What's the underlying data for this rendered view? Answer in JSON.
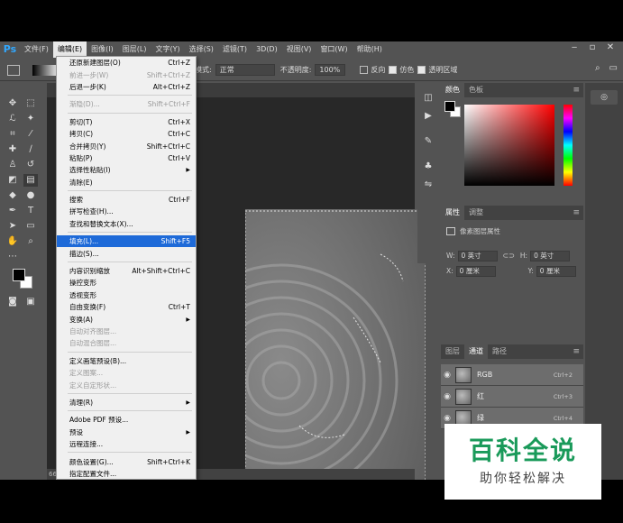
{
  "app": {
    "logo": "Ps"
  },
  "menubar": {
    "items": [
      "文件(F)",
      "编辑(E)",
      "图像(I)",
      "图层(L)",
      "文字(Y)",
      "选择(S)",
      "滤镜(T)",
      "3D(D)",
      "视图(V)",
      "窗口(W)",
      "帮助(H)"
    ],
    "active_index": 1,
    "window_controls": [
      "‒",
      "▫",
      "✕"
    ]
  },
  "options_bar": {
    "mode_label": "模式:",
    "mode_value": "正常",
    "opacity_label": "不透明度:",
    "opacity_value": "100%",
    "reverse_label": "反向",
    "dither_label": "仿色",
    "transparency_label": "透明区域"
  },
  "status_bar": {
    "zoom": "66"
  },
  "edit_menu": {
    "items": [
      {
        "label": "还原新建图层(O)",
        "shortcut": "Ctrl+Z",
        "disabled": false
      },
      {
        "label": "前进一步(W)",
        "shortcut": "Shift+Ctrl+Z",
        "disabled": true
      },
      {
        "label": "后退一步(K)",
        "shortcut": "Alt+Ctrl+Z",
        "disabled": false
      },
      {
        "sep": true
      },
      {
        "label": "渐隐(D)...",
        "shortcut": "Shift+Ctrl+F",
        "disabled": true
      },
      {
        "sep": true
      },
      {
        "label": "剪切(T)",
        "shortcut": "Ctrl+X",
        "disabled": false
      },
      {
        "label": "拷贝(C)",
        "shortcut": "Ctrl+C",
        "disabled": false
      },
      {
        "label": "合并拷贝(Y)",
        "shortcut": "Shift+Ctrl+C",
        "disabled": false
      },
      {
        "label": "粘贴(P)",
        "shortcut": "Ctrl+V",
        "disabled": false
      },
      {
        "label": "选择性粘贴(I)",
        "shortcut": "",
        "submenu": true,
        "disabled": false
      },
      {
        "label": "清除(E)",
        "shortcut": "",
        "disabled": false
      },
      {
        "sep": true
      },
      {
        "label": "搜索",
        "shortcut": "Ctrl+F",
        "disabled": false
      },
      {
        "label": "拼写检查(H)...",
        "shortcut": "",
        "disabled": false
      },
      {
        "label": "查找和替换文本(X)...",
        "shortcut": "",
        "disabled": false
      },
      {
        "sep": true
      },
      {
        "label": "填充(L)...",
        "shortcut": "Shift+F5",
        "disabled": false,
        "highlight": true
      },
      {
        "label": "描边(S)...",
        "shortcut": "",
        "disabled": false
      },
      {
        "sep": true
      },
      {
        "label": "内容识别缩放",
        "shortcut": "Alt+Shift+Ctrl+C",
        "disabled": false
      },
      {
        "label": "操控变形",
        "shortcut": "",
        "disabled": false
      },
      {
        "label": "透视变形",
        "shortcut": "",
        "disabled": false
      },
      {
        "label": "自由变换(F)",
        "shortcut": "Ctrl+T",
        "disabled": false
      },
      {
        "label": "变换(A)",
        "shortcut": "",
        "submenu": true,
        "disabled": false
      },
      {
        "label": "自动对齐图层...",
        "shortcut": "",
        "disabled": true
      },
      {
        "label": "自动混合图层...",
        "shortcut": "",
        "disabled": true
      },
      {
        "sep": true
      },
      {
        "label": "定义画笔预设(B)...",
        "shortcut": "",
        "disabled": false
      },
      {
        "label": "定义图案...",
        "shortcut": "",
        "disabled": true
      },
      {
        "label": "定义自定形状...",
        "shortcut": "",
        "disabled": true
      },
      {
        "sep": true
      },
      {
        "label": "清理(R)",
        "shortcut": "",
        "submenu": true,
        "disabled": false
      },
      {
        "sep": true
      },
      {
        "label": "Adobe PDF 预设...",
        "shortcut": "",
        "disabled": false
      },
      {
        "label": "预设",
        "shortcut": "",
        "submenu": true,
        "disabled": false
      },
      {
        "label": "远程连接...",
        "shortcut": "",
        "disabled": false
      },
      {
        "sep": true
      },
      {
        "label": "颜色设置(G)...",
        "shortcut": "Shift+Ctrl+K",
        "disabled": false
      },
      {
        "label": "指定配置文件...",
        "shortcut": "",
        "disabled": false
      }
    ]
  },
  "color_panel": {
    "tabs": [
      "颜色",
      "色板"
    ]
  },
  "properties_panel": {
    "tabs": [
      "属性",
      "调整"
    ],
    "title": "像素图层属性",
    "w_label": "W:",
    "w_value": "0 英寸",
    "h_label": "H:",
    "h_value": "0 英寸",
    "x_label": "X:",
    "x_value": "0 厘米",
    "y_label": "Y:",
    "y_value": "0 厘米"
  },
  "channels_panel": {
    "tabs": [
      "图层",
      "通道",
      "路径"
    ],
    "channels": [
      {
        "name": "RGB",
        "shortcut": "Ctrl+2"
      },
      {
        "name": "红",
        "shortcut": "Ctrl+3"
      },
      {
        "name": "绿",
        "shortcut": "Ctrl+4"
      }
    ]
  },
  "watermark": {
    "title": "百科全说",
    "subtitle": "助你轻松解决"
  }
}
